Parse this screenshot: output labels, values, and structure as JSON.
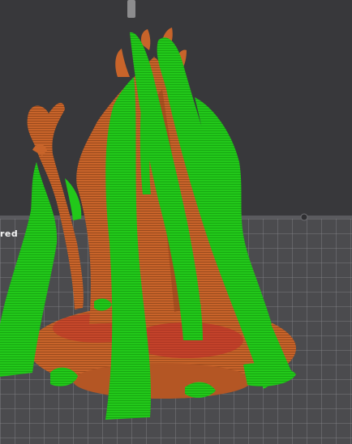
{
  "viewport": {
    "bed_label": "red",
    "colors": {
      "background": "#38383b",
      "bed": "#4b4b4e",
      "grid": "#8a8a8e",
      "model": "#c8642a",
      "model_shadow": "#8e3f18",
      "supports": "#22c81a",
      "supports_dark": "#139010",
      "overhang": "#c0262a"
    },
    "icons": [
      "nozzle-icon",
      "bed-clip-icon"
    ]
  }
}
